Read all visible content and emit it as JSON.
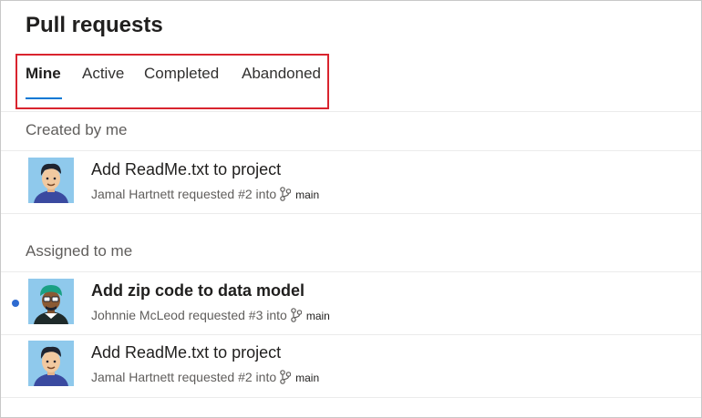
{
  "page": {
    "title": "Pull requests"
  },
  "tabs": [
    {
      "label": "Mine",
      "active": true
    },
    {
      "label": "Active",
      "active": false
    },
    {
      "label": "Completed",
      "active": false
    },
    {
      "label": "Abandoned",
      "active": false
    }
  ],
  "sections": [
    {
      "header": "Created by me",
      "items": [
        {
          "title": "Add ReadMe.txt to project",
          "meta": "Jamal Hartnett requested #2 into",
          "branch": "main",
          "avatar": "avatar-jamal"
        }
      ]
    },
    {
      "header": "Assigned to me",
      "items": [
        {
          "title": "Add zip code to data model",
          "meta": "Johnnie McLeod requested #3 into",
          "branch": "main",
          "avatar": "avatar-johnnie",
          "unread": true
        },
        {
          "title": "Add ReadMe.txt to project",
          "meta": "Jamal Hartnett requested #2 into",
          "branch": "main",
          "avatar": "avatar-jamal"
        }
      ]
    }
  ],
  "icons": {
    "branch": "branch-icon",
    "unread": "unread-dot"
  },
  "colors": {
    "accent": "#0078d4",
    "highlight_border": "#d9242e",
    "unread": "#2e6bd0"
  }
}
